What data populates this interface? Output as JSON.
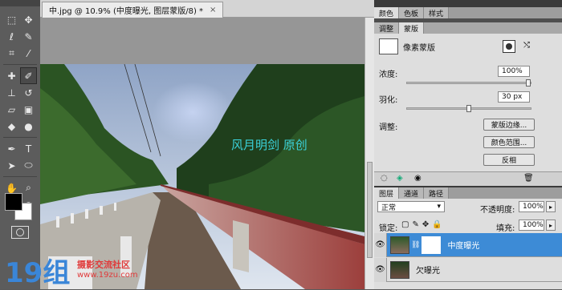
{
  "document": {
    "tab_title": "中.jpg @ 10.9% (中度曝光, 图层蒙版/8) *",
    "close_glyph": "×",
    "canvas_text": "风月明剑  原创"
  },
  "top_panel": {
    "tabs": [
      "颜色",
      "色板",
      "样式"
    ]
  },
  "adjust_panel": {
    "tabs": [
      "调整",
      "蒙版"
    ],
    "mask_type": "像素蒙版",
    "density_label": "浓度:",
    "density_value": "100%",
    "density_level": 1.0,
    "feather_label": "羽化:",
    "feather_value": "30 px",
    "feather_level": 0.5,
    "refine_label": "调整:",
    "buttons": [
      "蒙版边缘...",
      "颜色范围...",
      "反相"
    ]
  },
  "layers_panel": {
    "tabs": [
      "图层",
      "通道",
      "路径"
    ],
    "blend_mode": "正常",
    "opacity_label": "不透明度:",
    "opacity_value": "100%",
    "lock_label": "锁定:",
    "fill_label": "填充:",
    "fill_value": "100%",
    "layers": [
      {
        "name": "中度曝光",
        "active": true,
        "has_mask": true
      },
      {
        "name": "欠曝光",
        "active": false,
        "has_mask": false
      }
    ]
  },
  "watermark": {
    "logo_text": "19组",
    "site_name": "摄影交流社区",
    "url": "www.19zu.com"
  },
  "colors": {
    "accent": "#3d8bd6",
    "canvas_text": "#3ad0d8",
    "watermark_red": "#e03a3a"
  },
  "tools": [
    "move",
    "marquee",
    "lasso",
    "quick-select",
    "crop",
    "eyedropper",
    "healing",
    "brush",
    "stamp",
    "history-brush",
    "eraser",
    "gradient",
    "blur",
    "dodge",
    "pen",
    "text",
    "path-select",
    "shape",
    "hand",
    "zoom"
  ]
}
